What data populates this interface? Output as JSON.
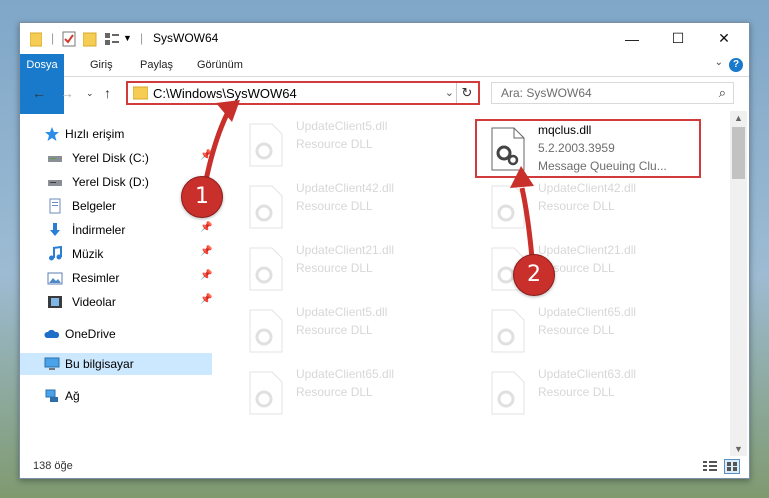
{
  "window": {
    "title": "SysWOW64",
    "controls": {
      "minimize": "—",
      "maximize": "☐",
      "close": "✕"
    }
  },
  "ribbon": {
    "tabs": [
      {
        "label": "Dosya"
      },
      {
        "label": "Giriş"
      },
      {
        "label": "Paylaş"
      },
      {
        "label": "Görünüm"
      }
    ],
    "help": "?"
  },
  "nav": {
    "address": "C:\\Windows\\SysWOW64",
    "search_placeholder": "Ara: SysWOW64"
  },
  "sidebar": {
    "items": [
      {
        "label": "Hızlı erişim",
        "icon": "star-icon",
        "pinned": false
      },
      {
        "label": "Yerel Disk (C:)",
        "icon": "drive-icon",
        "pinned": true
      },
      {
        "label": "Yerel Disk (D:)",
        "icon": "drive-icon",
        "pinned": false
      },
      {
        "label": "Belgeler",
        "icon": "documents-icon",
        "pinned": true
      },
      {
        "label": "İndirmeler",
        "icon": "download-icon",
        "pinned": true
      },
      {
        "label": "Müzik",
        "icon": "music-icon",
        "pinned": true
      },
      {
        "label": "Resimler",
        "icon": "pictures-icon",
        "pinned": true
      },
      {
        "label": "Videolar",
        "icon": "videos-icon",
        "pinned": true
      },
      {
        "label": "OneDrive",
        "icon": "cloud-icon",
        "pinned": false
      },
      {
        "label": "Bu bilgisayar",
        "icon": "computer-icon",
        "pinned": false,
        "selected": true
      },
      {
        "label": "Ağ",
        "icon": "network-icon",
        "pinned": false
      }
    ]
  },
  "files": {
    "left_column": [
      {
        "name": "UpdateClient5.dll",
        "type": "Resource DLL"
      },
      {
        "name": "UpdateClient42.dll",
        "type": "Resource DLL"
      },
      {
        "name": "UpdateClient21.dll",
        "type": "Resource DLL"
      },
      {
        "name": "UpdateClient5.dll",
        "type": "Resource DLL"
      },
      {
        "name": "UpdateClient65.dll",
        "type": "Resource DLL"
      }
    ],
    "right_column": [
      {
        "name": "mqclus.dll",
        "version": "5.2.2003.3959",
        "description": "Message Queuing Clu..."
      },
      {
        "name": "UpdateClient42.dll",
        "type": "Resource DLL"
      },
      {
        "name": "UpdateClient21.dll",
        "type": "Resource DLL"
      },
      {
        "name": "UpdateClient65.dll",
        "type": "Resource DLL"
      },
      {
        "name": "UpdateClient63.dll",
        "type": "Resource DLL"
      }
    ]
  },
  "status": {
    "count": "138 öğe"
  },
  "annotations": {
    "step1": "1",
    "step2": "2",
    "color": "#c9302c"
  }
}
